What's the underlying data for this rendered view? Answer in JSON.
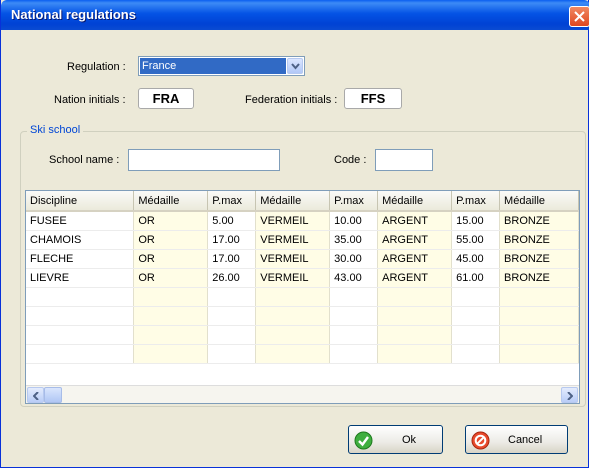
{
  "window": {
    "title": "National regulations"
  },
  "regulation": {
    "label": "Regulation :",
    "value": "France"
  },
  "nation": {
    "label": "Nation initials :",
    "value": "FRA"
  },
  "federation": {
    "label": "Federation initials :",
    "value": "FFS"
  },
  "ski_school": {
    "title": "Ski school",
    "school_name_label": "School name :",
    "school_name_value": "",
    "code_label": "Code :",
    "code_value": ""
  },
  "table": {
    "headers": [
      "Discipline",
      "Médaille",
      "P.max",
      "Médaille",
      "P.max",
      "Médaille",
      "P.max",
      "Médaille"
    ],
    "rows": [
      [
        "FUSEE",
        "OR",
        "5.00",
        "VERMEIL",
        "10.00",
        "ARGENT",
        "15.00",
        "BRONZE"
      ],
      [
        "CHAMOIS",
        "OR",
        "17.00",
        "VERMEIL",
        "35.00",
        "ARGENT",
        "55.00",
        "BRONZE"
      ],
      [
        "FLECHE",
        "OR",
        "17.00",
        "VERMEIL",
        "30.00",
        "ARGENT",
        "45.00",
        "BRONZE"
      ],
      [
        "LIEVRE",
        "OR",
        "26.00",
        "VERMEIL",
        "43.00",
        "ARGENT",
        "61.00",
        "BRONZE"
      ],
      [
        "",
        "",
        "",
        "",
        "",
        "",
        "",
        ""
      ],
      [
        "",
        "",
        "",
        "",
        "",
        "",
        "",
        ""
      ],
      [
        "",
        "",
        "",
        "",
        "",
        "",
        "",
        ""
      ],
      [
        "",
        "",
        "",
        "",
        "",
        "",
        "",
        ""
      ]
    ]
  },
  "buttons": {
    "ok": "Ok",
    "cancel": "Cancel"
  },
  "icons": {
    "close": "close-icon",
    "dropdown": "chevron-down-icon",
    "ok": "check-circle-icon",
    "cancel": "forbidden-circle-icon",
    "scroll_left": "arrow-left-icon",
    "scroll_right": "arrow-right-icon"
  },
  "colors": {
    "titlebar": "#0453e5",
    "selection": "#316ac5",
    "group_title": "#0046d5",
    "cell_highlight": "#fffde6"
  }
}
